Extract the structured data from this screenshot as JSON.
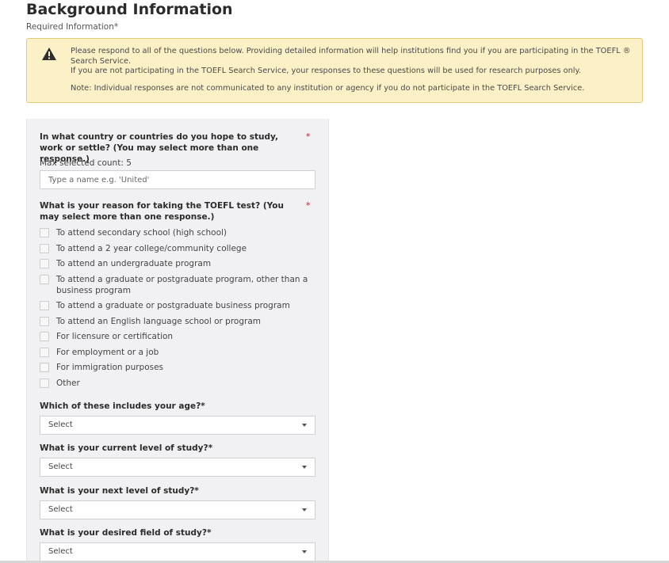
{
  "header": {
    "title": "Background Information",
    "required_note": "Required Information*"
  },
  "alert": {
    "icon": "warning-icon",
    "line1": "Please respond to all of the questions below. Providing detailed information will help institutions find you if you are participating in the TOEFL ® Search Service.",
    "line2": "If you are not participating in the TOEFL Search Service, your responses to these questions will be used for research purposes only.",
    "note": "Note: Individual responses are not communicated to any institution or agency if you do not participate in the TOEFL Search Service."
  },
  "form": {
    "country": {
      "label": "In what country or countries do you hope to study, work or settle? (You may select more than one response.)",
      "required": "*",
      "max_count": "Max selected count: 5",
      "placeholder": "Type a name e.g. 'United'"
    },
    "reason": {
      "label": "What is your reason for taking the TOEFL test? (You may select more than one response.)",
      "required": "*",
      "options": [
        "To attend secondary school (high school)",
        "To attend a 2 year college/community college",
        "To attend an undergraduate program",
        "To attend a graduate or postgraduate program, other than a business program",
        "To attend a graduate or postgraduate business program",
        "To attend an English language school or program",
        "For licensure or certification",
        "For employment or a job",
        "For immigration purposes",
        "Other"
      ]
    },
    "age": {
      "label": "Which of these includes your age?*",
      "value": "Select"
    },
    "current_level": {
      "label": "What is your current level of study?*",
      "value": "Select"
    },
    "next_level": {
      "label": "What is your next level of study?*",
      "value": "Select"
    },
    "field": {
      "label": "What is your desired field of study?*",
      "value": "Select"
    }
  },
  "colors": {
    "alert_bg": "#fcf0c6",
    "alert_border": "#e3c97a",
    "panel_bg": "#f1f1f3",
    "required_star": "#b0263a"
  }
}
